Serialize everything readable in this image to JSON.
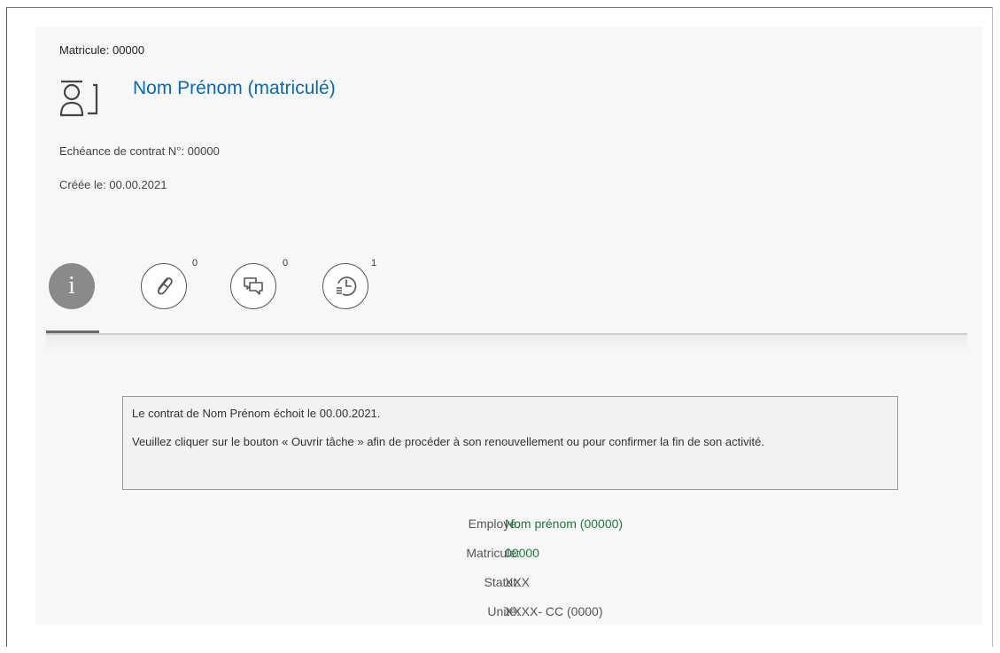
{
  "header": {
    "matricule_line": "Matricule: 00000",
    "title": "Nom Prénom (matriculé)",
    "echeance_line": "Echéance de contrat N°: 00000",
    "creee_line": "Créée le: 00.00.2021"
  },
  "tabs": [
    {
      "name": "info",
      "label": "i",
      "icon": "info-icon"
    },
    {
      "name": "attachments",
      "count": "0",
      "icon": "paperclip-icon"
    },
    {
      "name": "comments",
      "count": "0",
      "icon": "comments-icon"
    },
    {
      "name": "history",
      "count": "1",
      "icon": "history-icon"
    }
  ],
  "message": {
    "line1": "Le contrat de Nom Prénom échoit le 00.00.2021.",
    "line2": "Veuillez cliquer sur le bouton « Ouvrir tâche » afin de procéder à son renouvellement ou pour confirmer la fin de son activité."
  },
  "details": [
    {
      "label": "Employé:",
      "value": "Nom prénom (00000)"
    },
    {
      "label": "Matricule:",
      "value": "00000"
    },
    {
      "label": "Statut:",
      "value": "XXX"
    },
    {
      "label": "Unité:",
      "value": "XXXX- CC (0000)"
    }
  ],
  "colors": {
    "title": "#0a6ab0",
    "value_green": "#1a7a3a",
    "tab_active": "#8a8a8a"
  }
}
